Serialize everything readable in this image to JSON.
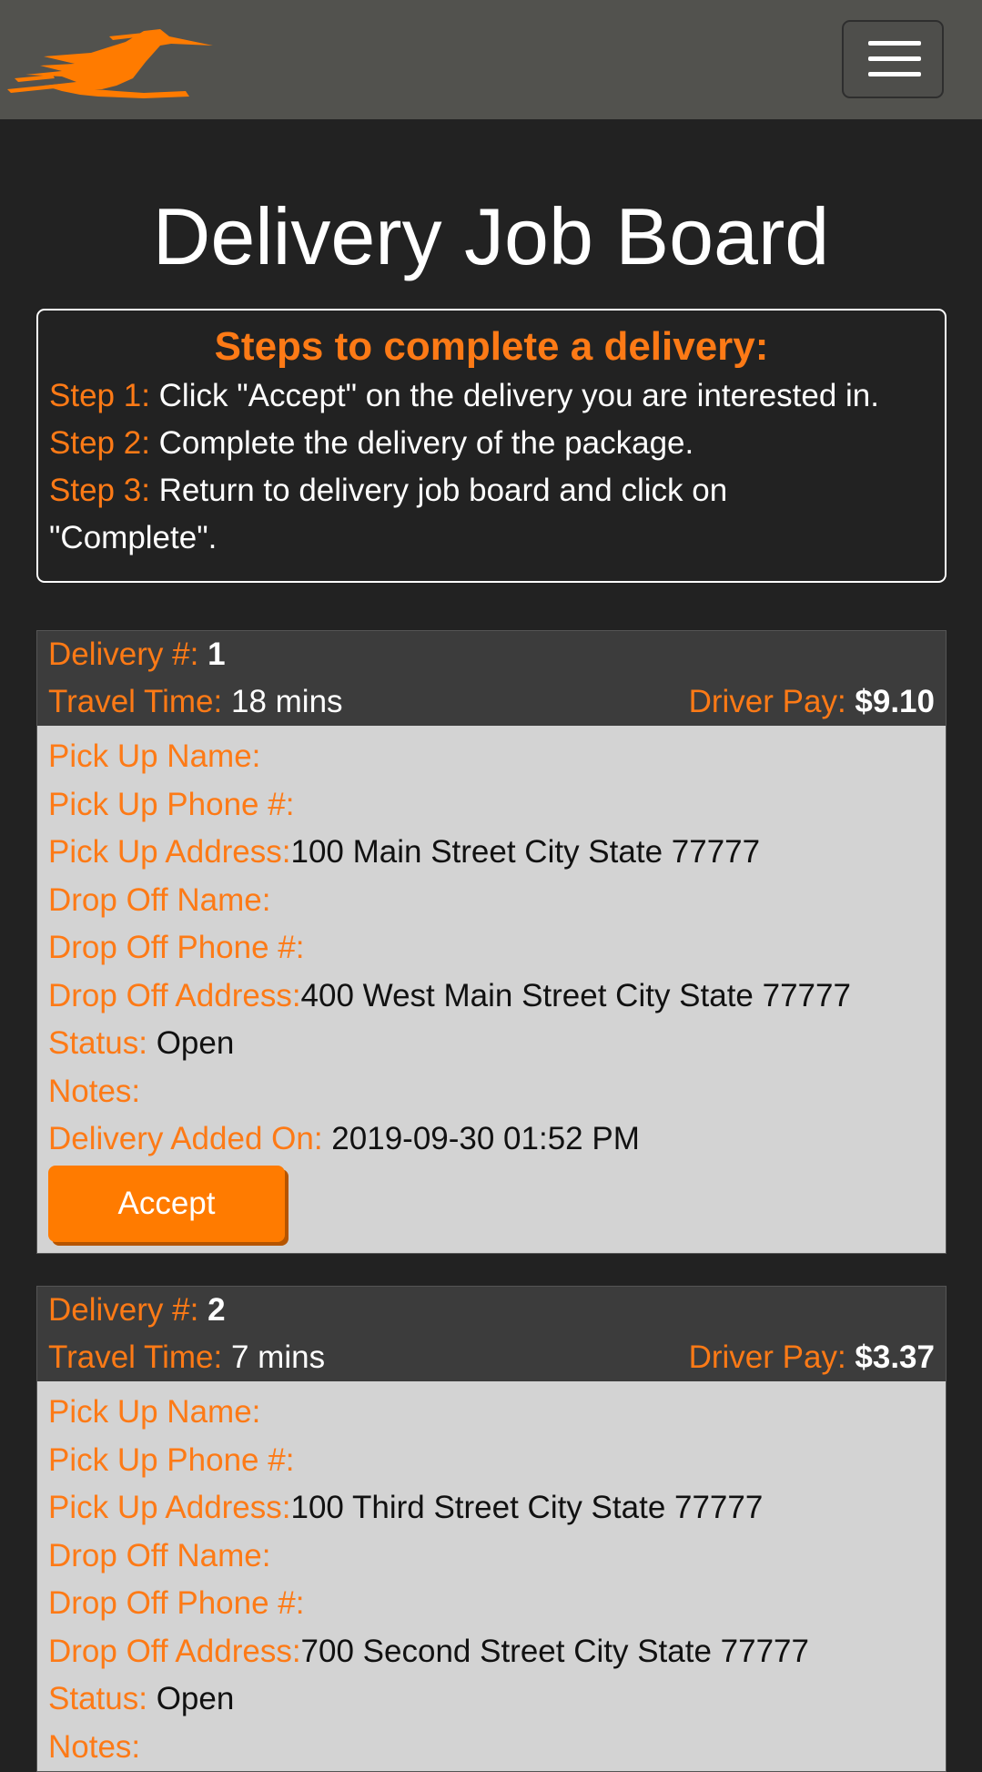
{
  "header": {
    "logo_icon": "roadrunner-logo-icon",
    "menu_icon": "hamburger-menu-icon"
  },
  "page_title": "Delivery Job Board",
  "steps": {
    "heading": "Steps to complete a delivery:",
    "items": [
      {
        "label": "Step 1:",
        "text": "Click \"Accept\" on the delivery you are interested in."
      },
      {
        "label": "Step 2:",
        "text": "Complete the delivery of the package."
      },
      {
        "label": "Step 3:",
        "text": "Return to delivery job board and click on"
      },
      {
        "label": "",
        "text": "\"Complete\"."
      }
    ]
  },
  "labels": {
    "delivery_no": "Delivery #:",
    "travel_time": "Travel Time:",
    "driver_pay": "Driver Pay:",
    "pickup_name": "Pick Up Name:",
    "pickup_phone": "Pick Up Phone #:",
    "pickup_address": "Pick Up Address:",
    "dropoff_name": "Drop Off Name:",
    "dropoff_phone": "Drop Off Phone #:",
    "dropoff_address": "Drop Off Address:",
    "status": "Status:",
    "notes": "Notes:",
    "added_on": "Delivery Added On:",
    "accept_button": "Accept"
  },
  "deliveries": [
    {
      "number": "1",
      "travel_time": "18 mins",
      "driver_pay": "$9.10",
      "pickup_name": "",
      "pickup_phone": "",
      "pickup_address": "100 Main Street City State 77777",
      "dropoff_name": "",
      "dropoff_phone": "",
      "dropoff_address": "400 West Main Street City State 77777",
      "status": "Open",
      "notes": "",
      "added_on": "2019-09-30 01:52 PM"
    },
    {
      "number": "2",
      "travel_time": "7 mins",
      "driver_pay": "$3.37",
      "pickup_name": "",
      "pickup_phone": "",
      "pickup_address": "100 Third Street City State 77777",
      "dropoff_name": "",
      "dropoff_phone": "",
      "dropoff_address": "700 Second Street City State 77777",
      "status": "Open",
      "notes": ""
    }
  ],
  "colors": {
    "accent": "#fd7a16",
    "background": "#222222",
    "navbar": "#52524e",
    "card_header": "#3c3c3c",
    "card_body": "#d3d3d3",
    "button": "#ff7b00"
  }
}
